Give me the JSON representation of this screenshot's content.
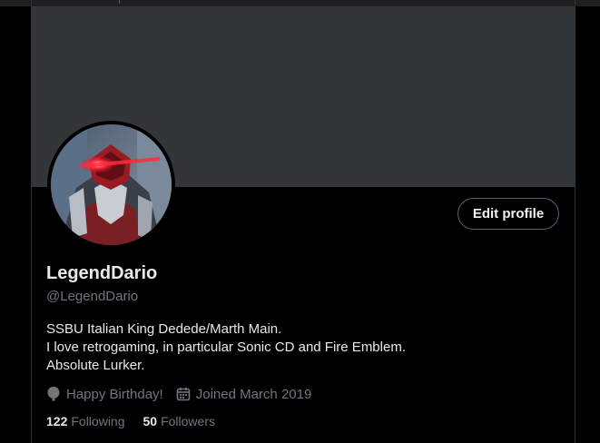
{
  "profile": {
    "display_name": "LegendDario",
    "handle": "@LegendDario",
    "edit_label": "Edit profile",
    "bio": [
      "SSBU Italian King Dedede/Marth Main.",
      "I love retrogaming, in particular Sonic CD and Fire Emblem.",
      "Absolute Lurker."
    ],
    "birthday_text": "Happy Birthday!",
    "joined_text": "Joined March 2019",
    "following_count": "122",
    "following_label": "Following",
    "followers_count": "50",
    "followers_label": "Followers"
  },
  "icons": {
    "birthday": "balloon-icon",
    "joined": "calendar-icon"
  },
  "colors": {
    "background": "#000000",
    "banner": "#333639",
    "primary_text": "#e7e9ea",
    "secondary_text": "#71767b",
    "button_border": "#536471"
  }
}
